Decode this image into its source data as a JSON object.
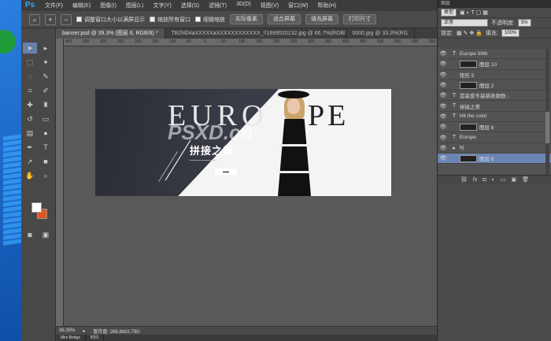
{
  "app": {
    "logo": "Ps"
  },
  "menu": [
    "文件(F)",
    "编辑(E)",
    "图像(I)",
    "图层(L)",
    "文字(Y)",
    "选择(S)",
    "滤镜(T)",
    "3D(D)",
    "视图(V)",
    "窗口(W)",
    "帮助(H)"
  ],
  "options": {
    "check1": "调整窗口大小以满屏显示",
    "check2": "缩放所有窗口",
    "check3": "细微缩放",
    "btn1": "实际像素",
    "btn2": "适合屏幕",
    "btn3": "填充屏幕",
    "btn4": "打印尺寸"
  },
  "tabs": [
    "banner.psd @ 39.3% (图层 6, RGB/8) *",
    "TB2hl04aXXXXXaXXXXXXXXXXXX_!!1699520132.jpg @ 66.7%(RGB/8#)",
    "0000.jpg @ 33.3%(RG"
  ],
  "ruler_ticks": [
    "400",
    "350",
    "300",
    "250",
    "200",
    "150",
    "100",
    "50",
    "0",
    "50",
    "100",
    "150",
    "200",
    "250",
    "300",
    "350",
    "400",
    "450",
    "500",
    "550",
    "600",
    "650"
  ],
  "banner": {
    "title_left": "EURO",
    "title_right": "PE",
    "cn_title": "拼接之美",
    "watermark": "PSXD.cn"
  },
  "status": {
    "zoom": "36.35%",
    "doc": "暂存盘: 286.8M/2.79G"
  },
  "minibar": [
    "Mini Bridge",
    "时间"
  ],
  "panel": {
    "title": "图层",
    "filter": "类型",
    "blend": "正常",
    "opacity_label": "不透明度:",
    "opacity": "5%",
    "lock_label": "锁定:",
    "fill_label": "填充:",
    "fill": "100%",
    "layers": [
      {
        "kind": "T",
        "name": "Europe 50th",
        "thumb": false
      },
      {
        "kind": "",
        "name": "图层 10",
        "thumb": true
      },
      {
        "kind": "",
        "name": "矩形 5",
        "thumb": false
      },
      {
        "kind": "",
        "name": "图层 2",
        "thumb": true
      },
      {
        "kind": "T",
        "name": "首装爱冬装新款款欧...",
        "thumb": false
      },
      {
        "kind": "T",
        "name": "拼接之美",
        "thumb": false
      },
      {
        "kind": "T",
        "name": "Hit the color",
        "thumb": false
      },
      {
        "kind": "",
        "name": "图层 8",
        "thumb": true
      },
      {
        "kind": "T",
        "name": "Europe",
        "thumb": false
      },
      {
        "kind": "▸",
        "name": "bj",
        "thumb": false
      },
      {
        "kind": "",
        "name": "图层 6",
        "thumb": true
      }
    ]
  }
}
